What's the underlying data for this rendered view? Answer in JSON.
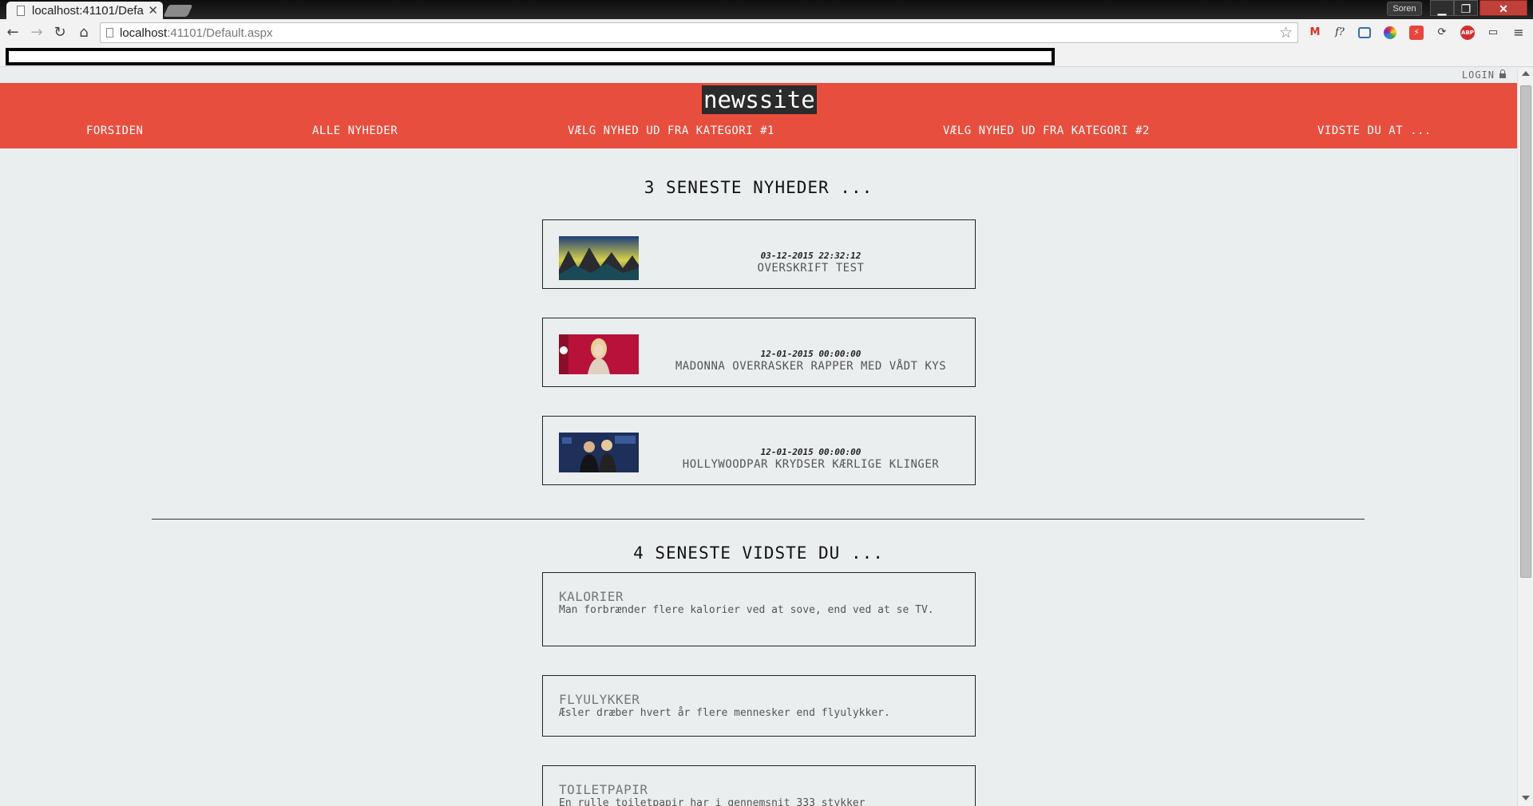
{
  "browser": {
    "tab_title": "localhost:41101/Defa",
    "tab_close": "✕",
    "profile_name": "Soren",
    "url_host": "localhost",
    "url_rest": ":41101/Default.aspx",
    "window_min": "▁",
    "window_max": "❐",
    "window_close": "✕"
  },
  "page": {
    "login_label": "LOGIN",
    "site_title": "newssite",
    "nav": [
      "FORSIDEN",
      "ALLE NYHEDER",
      "VÆLG NYHED UD FRA KATEGORI #1",
      "VÆLG NYHED UD FRA KATEGORI #2",
      "VIDSTE DU AT ..."
    ],
    "news_section_title": "3 SENESTE NYHEDER ...",
    "news": [
      {
        "date": "03-12-2015 22:32:12",
        "title": "OVERSKRIFT TEST",
        "image": "landscape-mountains"
      },
      {
        "date": "12-01-2015 00:00:00",
        "title": "MADONNA OVERRASKER RAPPER MED VÅDT KYS",
        "image": "woman-on-red-stage"
      },
      {
        "date": "12-01-2015 00:00:00",
        "title": "HOLLYWOODPAR KRYDSER KÆRLIGE KLINGER",
        "image": "couple-red-carpet"
      }
    ],
    "facts_section_title": "4 SENESTE VIDSTE DU ...",
    "facts": [
      {
        "title": "KALORIER",
        "text": "Man forbrænder flere kalorier ved at sove, end ved at se TV."
      },
      {
        "title": "FLYULYKKER",
        "text": "Æsler dræber hvert år flere mennesker end flyulykker."
      },
      {
        "title": "TOILETPAPIR",
        "text": "En rulle toiletpapir har i gennemsnit 333 stykker"
      }
    ]
  },
  "colors": {
    "header": "#e84e3e",
    "page_background": "#ebeeee",
    "logo_background": "#2b2b2b"
  }
}
